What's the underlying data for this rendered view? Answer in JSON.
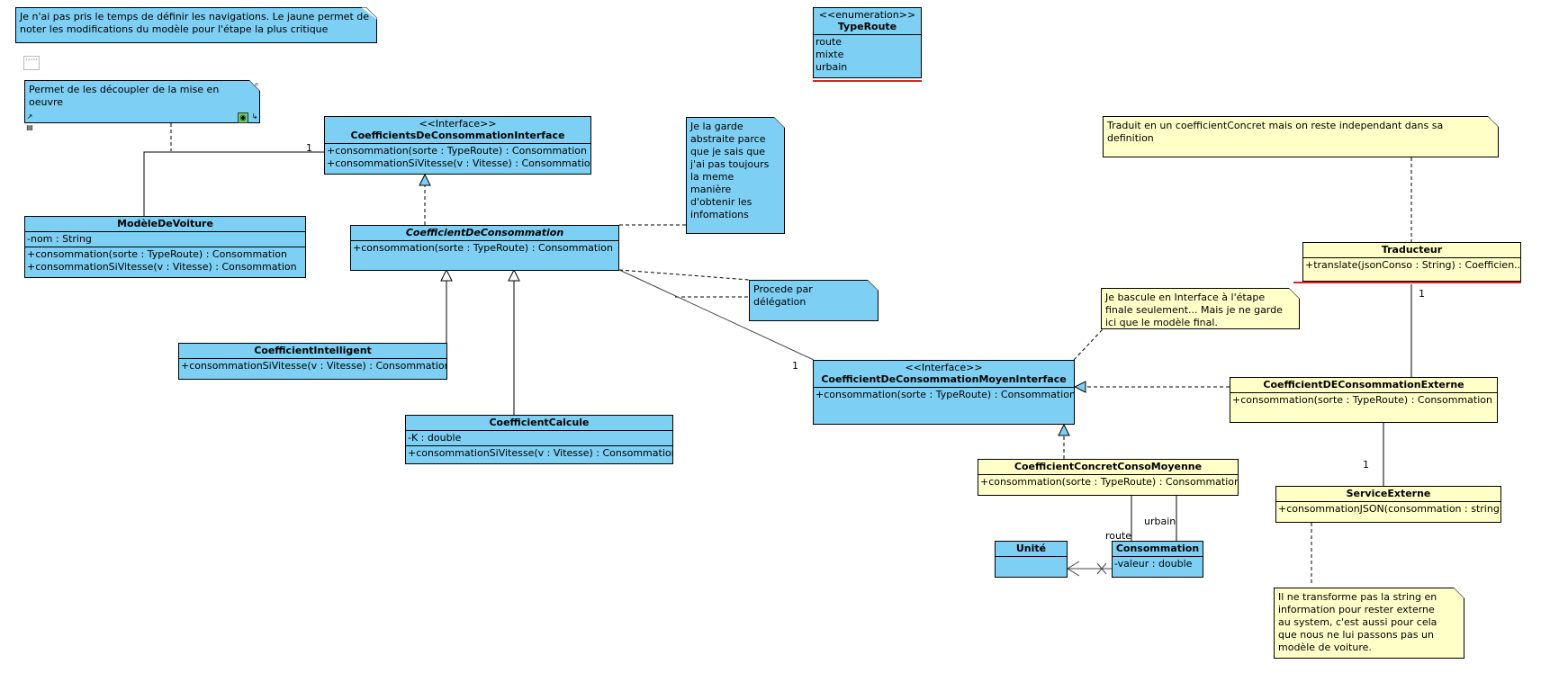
{
  "notes": {
    "navigation": "Je n'ai pas pris le temps de définir les navigations. Le jaune permet de\nnoter les modifications du modèle pour l'étape la plus critique",
    "decoupler": "Permet de les découpler de la mise en\noeuvre",
    "abstraite": "Je la garde\nabstraite parce\nque je sais que\nj'ai pas toujours\nla meme\nmanière\nd'obtenir les\ninfomations",
    "delegation": "Procede par\ndélégation",
    "traduit": "Traduit en un coefficientConcret mais on reste independant dans sa\ndefinition",
    "bascule": "Je bascule en Interface à l'étape\nfinale seulement... Mais je ne garde\nici que le modèle final.",
    "service": "Il ne transforme pas la string en\ninformation pour rester externe\nau system, c'est aussi pour cela\nque nous ne lui passons pas un\nmodèle de voiture."
  },
  "classes": {
    "typeRoute": {
      "stereotype": "<<enumeration>>",
      "name": "TypeRoute",
      "literals": [
        "route",
        "mixte",
        "urbain"
      ]
    },
    "coeffInterface": {
      "stereotype": "<<Interface>>",
      "name": "CoefficientsDeConsommationInterface",
      "ops": [
        "+consommation(sorte : TypeRoute) : Consommation",
        "+consommationSiVitesse(v : Vitesse) : Consommation"
      ]
    },
    "modele": {
      "name": "ModèleDeVoiture",
      "attrs": [
        "-nom : String"
      ],
      "ops": [
        "+consommation(sorte : TypeRoute) : Consommation",
        "+consommationSiVitesse(v : Vitesse) : Consommation"
      ]
    },
    "coeffAbstract": {
      "name": "CoefficientDeConsommation",
      "ops": [
        "+consommation(sorte : TypeRoute) : Consommation"
      ]
    },
    "coeffIntelligent": {
      "name": "CoefficientIntelligent",
      "ops": [
        "+consommationSiVitesse(v : Vitesse) : Consommation"
      ]
    },
    "coeffCalcule": {
      "name": "CoefficientCalcule",
      "attrs": [
        "-K : double"
      ],
      "ops": [
        "+consommationSiVitesse(v : Vitesse) : Consommation"
      ]
    },
    "moyenInterface": {
      "stereotype": "<<Interface>>",
      "name": "CoefficientDeConsommationMoyenInterface",
      "ops": [
        "+consommation(sorte : TypeRoute) : Consommation"
      ]
    },
    "concretMoyenne": {
      "name": "CoefficientConcretConsoMoyenne",
      "ops": [
        "+consommation(sorte : TypeRoute) : Consommation"
      ]
    },
    "unite": {
      "name": "Unité"
    },
    "consommation": {
      "name": "Consommation",
      "attrs": [
        "-valeur : double"
      ]
    },
    "traducteur": {
      "name": "Traducteur",
      "ops": [
        "+translate(jsonConso : String) : Coefficien..."
      ]
    },
    "externe": {
      "name": "CoefficientDEConsommationExterne",
      "ops": [
        "+consommation(sorte : TypeRoute) : Consommation"
      ]
    },
    "service": {
      "name": "ServiceExterne",
      "ops": [
        "+consommationJSON(consommation : string)"
      ]
    }
  },
  "multiplicities": {
    "modeleToInterface": "1",
    "abstractToMoyen": "1",
    "traducteurToExterne": "1",
    "externeToService": "1"
  },
  "roles": {
    "route": "route",
    "urbain": "urbain"
  },
  "colors": {
    "blue": "#7dcff3",
    "yellow": "#ffffc8",
    "red": "#e02020"
  }
}
